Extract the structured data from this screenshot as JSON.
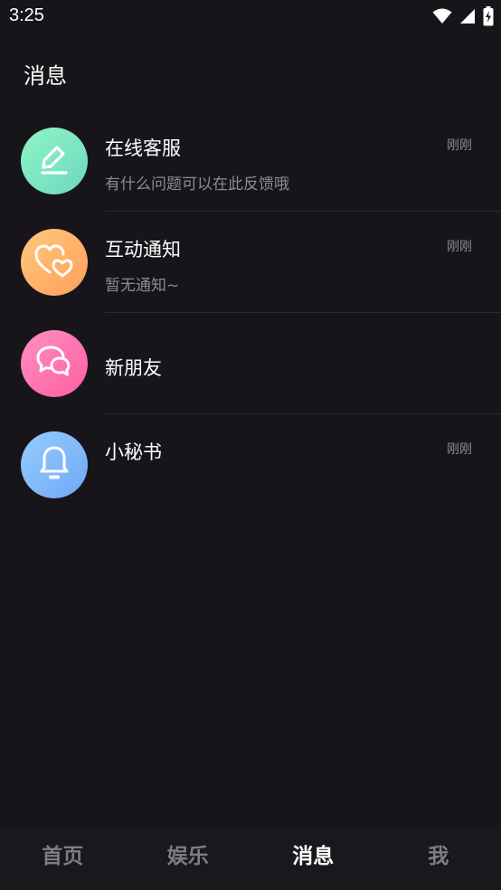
{
  "status_bar": {
    "time": "3:25",
    "icons": [
      "wifi-icon",
      "signal-icon",
      "battery-icon"
    ]
  },
  "header": {
    "title": "消息"
  },
  "messages": [
    {
      "title": "在线客服",
      "subtitle": "有什么问题可以在此反馈哦",
      "time": "刚刚",
      "icon": "pencil-icon",
      "gradient": [
        "#8af0c8",
        "#6fd6b8"
      ]
    },
    {
      "title": "互动通知",
      "subtitle": "暂无通知~",
      "time": "刚刚",
      "icon": "hearts-icon",
      "gradient": [
        "#ffc278",
        "#ffa05a"
      ]
    },
    {
      "title": "新朋友",
      "subtitle": "",
      "time": "",
      "icon": "chat-bubbles-icon",
      "gradient": [
        "#ff86c0",
        "#ff5fa2"
      ]
    },
    {
      "title": "小秘书",
      "subtitle": "",
      "time": "刚刚",
      "icon": "bell-icon",
      "gradient": [
        "#8fc6ff",
        "#72aef7"
      ]
    }
  ],
  "bottom_nav": {
    "items": [
      "首页",
      "娱乐",
      "消息",
      "我"
    ],
    "active": "消息"
  }
}
